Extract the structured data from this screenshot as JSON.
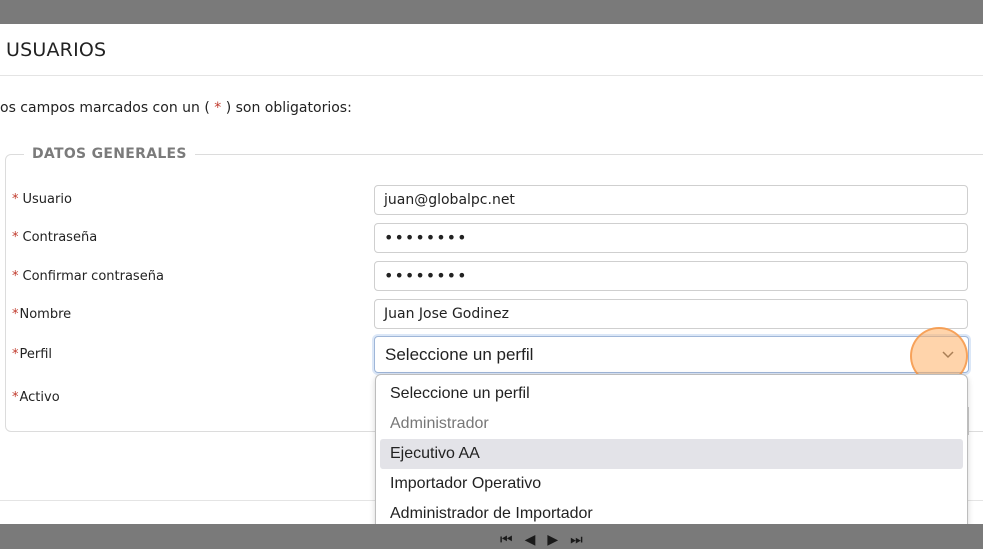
{
  "header": {
    "title": "USUARIOS"
  },
  "note": {
    "before": "os campos marcados con un ( ",
    "star": "*",
    "after": " ) son obligatorios:"
  },
  "section": {
    "legend": "DATOS GENERALES"
  },
  "required_mark": "*",
  "fields": {
    "usuario": {
      "label": "Usuario",
      "value": "juan@globalpc.net"
    },
    "contrasena": {
      "label": "Contraseña",
      "value": "••••••••"
    },
    "confirmar": {
      "label": "Confirmar contraseña",
      "value": "••••••••"
    },
    "nombre": {
      "label": "Nombre",
      "value": "Juan Jose Godinez"
    },
    "perfil": {
      "label": "Perfil",
      "value": "Seleccione un perfil"
    },
    "activo": {
      "label": "Activo"
    }
  },
  "perfil_options": [
    {
      "label": "Seleccione un perfil",
      "state": "normal"
    },
    {
      "label": "Administrador",
      "state": "disabled"
    },
    {
      "label": "Ejecutivo AA",
      "state": "hover"
    },
    {
      "label": "Importador Operativo",
      "state": "normal"
    },
    {
      "label": "Administrador de Importador",
      "state": "normal"
    }
  ],
  "pager": {
    "first": "⏮",
    "prev": "◀",
    "next": "▶",
    "last": "⏭"
  },
  "colors": {
    "required": "#c0392b",
    "focus_ring": "#9fb6d8",
    "click_highlight": "#ffb066"
  }
}
